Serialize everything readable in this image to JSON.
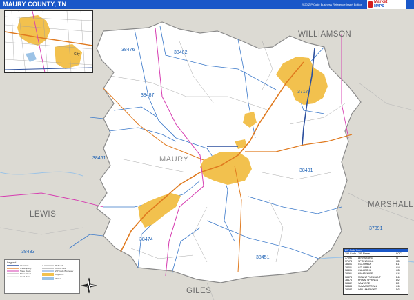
{
  "header": {
    "title": "MAURY COUNTY, TN",
    "edition": "2020 ZIP Code Business Reference Insert Edition",
    "logo_top": "Market",
    "logo_bottom": "MAPS"
  },
  "map": {
    "county_name": "MAURY",
    "neighbor_counties": [
      "WILLIAMSON",
      "MARSHALL",
      "LEWIS",
      "GILES"
    ],
    "zip_labels": [
      "38476",
      "38482",
      "38487",
      "37174",
      "38461",
      "38401",
      "38474",
      "38451",
      "37091",
      "38483"
    ],
    "colors": {
      "land": "#ffffff",
      "outside": "#dcdad3",
      "urban": "#f2c14e",
      "zip_boundary": "#3a78c9",
      "interstate": "#2b4f9e",
      "highway": "#e07a1f",
      "route": "#d63bb0",
      "water": "#9cc3e6"
    }
  },
  "inset": {
    "label": "City"
  },
  "legend": {
    "title": "Legend",
    "items": [
      "Interstate",
      "US Highway",
      "State Route",
      "Major Road",
      "Local Road",
      "Railroad",
      "County Line",
      "ZIP Code Boundary",
      "City Limit",
      "Water"
    ]
  },
  "zip_index": {
    "title": "ZIP Code Index",
    "headers": [
      "ZIP Code",
      "ZIP Name",
      "LOC"
    ],
    "rows": [
      [
        "37091",
        "LEWISBURG",
        "I6"
      ],
      [
        "37174",
        "SPRING HILL",
        "H5"
      ],
      [
        "38401",
        "COLUMBIA",
        "B1"
      ],
      [
        "38401",
        "COLUMBIA",
        "G4"
      ],
      [
        "38401",
        "CULLEOKA",
        "G5"
      ],
      [
        "38461",
        "HAMPSHIRE",
        "C4"
      ],
      [
        "38474",
        "MOUNT PLEASANT",
        "D6"
      ],
      [
        "38476",
        "PRIMM SPRINGS",
        "D2"
      ],
      [
        "38482",
        "SANTA FE",
        "E2"
      ],
      [
        "38483",
        "SUMMERTOWN",
        "C6"
      ],
      [
        "38487",
        "WILLIAMSPORT",
        "D3"
      ]
    ]
  }
}
